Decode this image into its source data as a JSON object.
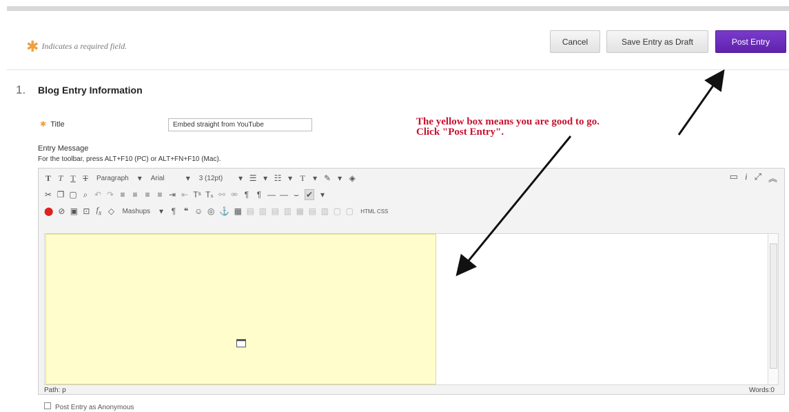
{
  "form": {
    "required_note": "Indicates a required field.",
    "required_star": "✱",
    "buttons": {
      "cancel": "Cancel",
      "save_draft": "Save Entry as Draft",
      "post": "Post Entry"
    }
  },
  "section": {
    "number": "1.",
    "title": "Blog Entry Information"
  },
  "fields": {
    "title_label": "Title",
    "title_value": "Embed straight from YouTube",
    "entry_message_label": "Entry Message",
    "toolbar_hint": "For the toolbar, press ALT+F10 (PC) or ALT+FN+F10 (Mac)."
  },
  "editor": {
    "toolbar_row1": {
      "paragraph": "Paragraph",
      "font": "Arial",
      "size": "3 (12pt)"
    },
    "toolbar_row3": {
      "mashups": "Mashups",
      "html_css": "HTML CSS"
    },
    "path_label": "Path: p",
    "words_label": "Words:0"
  },
  "options": {
    "anonymous": "Post Entry as Anonymous"
  },
  "annotation": {
    "line1": "The yellow box means you are good to go.",
    "line2": "Click \"Post Entry\"."
  },
  "colors": {
    "post_button": "#6a2bbb",
    "required_star": "#f0a040",
    "annotation_text": "#c8102e",
    "embed_highlight": "#fffdcc"
  }
}
